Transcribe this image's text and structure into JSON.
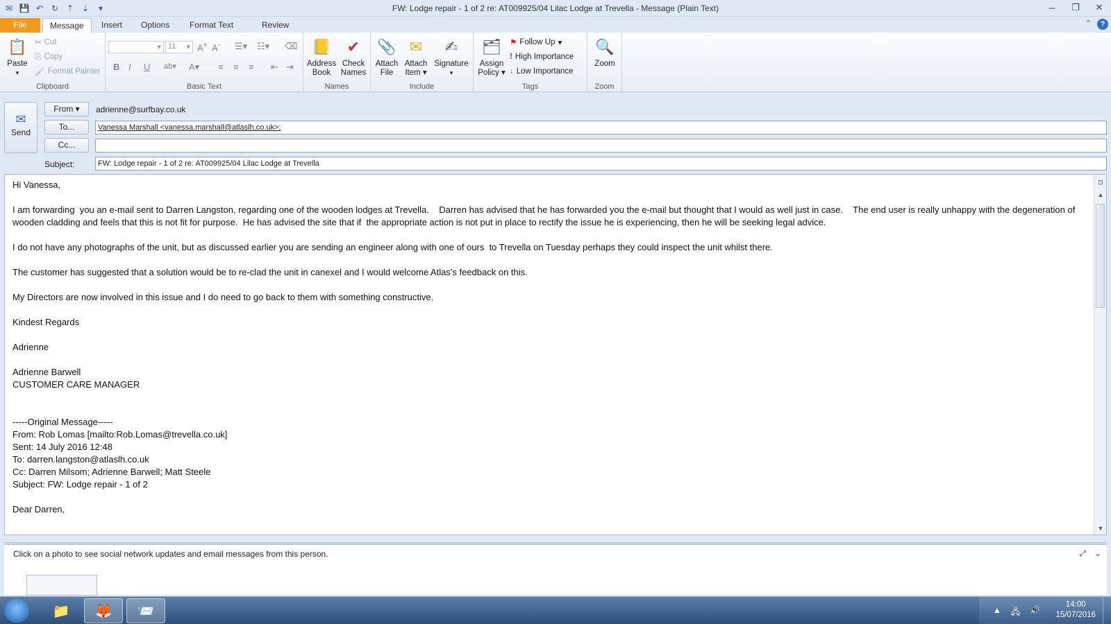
{
  "window": {
    "title": "FW: Lodge repair - 1 of 2 re: AT009925/04 Lilac Lodge at Trevella  -  Message (Plain Text)"
  },
  "tabs": [
    "File",
    "Message",
    "Insert",
    "Options",
    "Format Text",
    "Review"
  ],
  "ribbon": {
    "clipboard": {
      "label": "Clipboard",
      "paste": "Paste",
      "cut": "Cut",
      "copy": "Copy",
      "format_painter": "Format Painter"
    },
    "basic_text": {
      "label": "Basic Text",
      "font_size": "11"
    },
    "names": {
      "label": "Names",
      "address_book": "Address Book",
      "check_names": "Check Names"
    },
    "include": {
      "label": "Include",
      "attach_file": "Attach File",
      "attach_item": "Attach Item",
      "signature": "Signature"
    },
    "tags": {
      "label": "Tags",
      "assign_policy": "Assign Policy",
      "follow_up": "Follow Up",
      "high_importance": "High Importance",
      "low_importance": "Low Importance"
    },
    "zoom": {
      "label": "Zoom",
      "zoom": "Zoom"
    }
  },
  "header": {
    "send_label": "Send",
    "from_button": "From",
    "from_value": "adrienne@surfbay.co.uk",
    "to_button": "To...",
    "to_value": "Vanessa Marshall <vanessa.marshall@atlaslh.co.uk>;",
    "cc_button": "Cc...",
    "cc_value": "",
    "subject_label": "Subject:",
    "subject_value": "FW: Lodge repair - 1 of 2 re: AT009925/04 Lilac Lodge at Trevella"
  },
  "body": {
    "greeting": "Hi Vanessa,",
    "para1": "I am forwarding  you an e-mail sent to Darren Langston, regarding one of the wooden lodges at Trevella.    Darren has advised that he has forwarded you the e-mail but thought that I would as well just in case.    The end user is really unhappy with the degeneration of wooden cladding and feels that this is not fit for purpose.  He has advised the site that if  the appropriate action is not put in place to rectify the issue he is experiencing, then he will be seeking legal advice.",
    "para2": "I do not have any photographs of the unit, but as discussed earlier you are sending an engineer along with one of ours  to Trevella on Tuesday perhaps they could inspect the unit whilst there.",
    "para3": "The customer has suggested that a solution would be to re-clad the unit in canexel and I would welcome Atlas's feedback on this.",
    "para4": "My Directors are now involved in this issue and I do need to go back to them with something constructive.",
    "regards": "Kindest Regards",
    "signoff": "Adrienne",
    "sig_name": "Adrienne Barwell",
    "sig_title": "CUSTOMER CARE MANAGER",
    "orig_header": "-----Original Message-----",
    "orig_from": "From: Rob Lomas [mailto:Rob.Lomas@trevella.co.uk]",
    "orig_sent": "Sent: 14 July 2016 12:48",
    "orig_to": "To: darren.langston@atlaslh.co.uk",
    "orig_cc": "Cc: Darren Milsom; Adrienne Barwell; Matt Steele",
    "orig_subject": "Subject: FW: Lodge repair - 1 of 2",
    "orig_greeting": "Dear Darren,"
  },
  "people_pane": {
    "message": "Click on a photo to see social network updates and email messages from this person."
  },
  "taskbar": {
    "time": "14:00",
    "date": "15/07/2016"
  }
}
